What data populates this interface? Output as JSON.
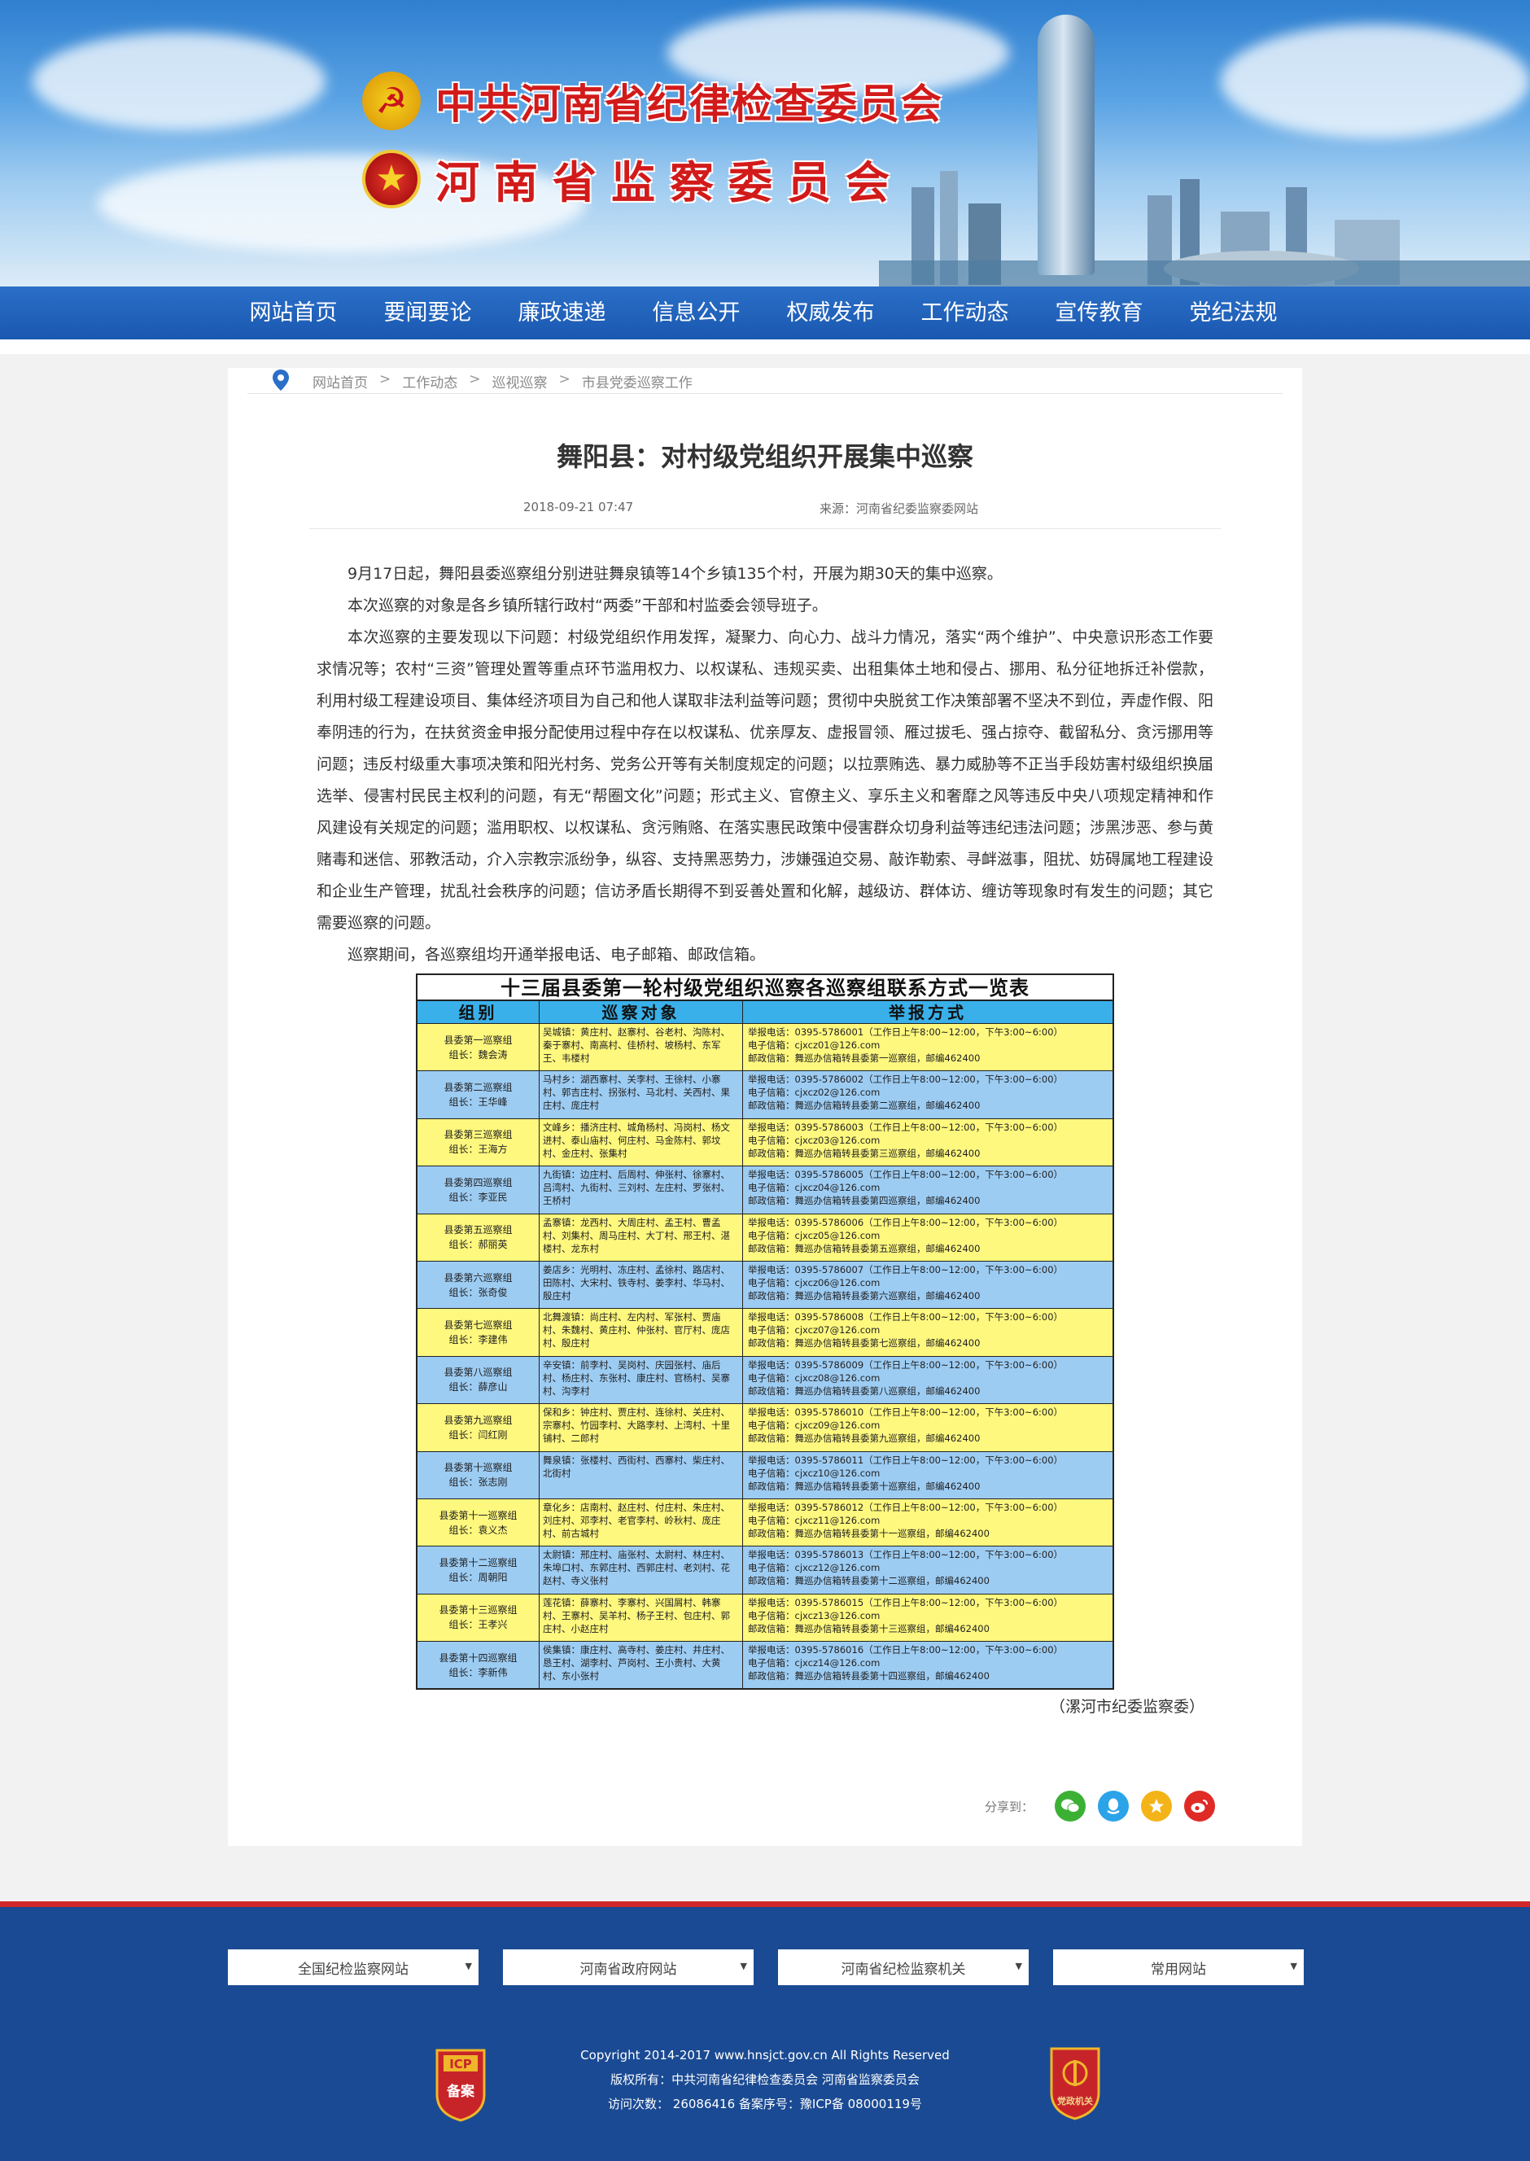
{
  "header": {
    "org_line1": "中共河南省纪律检查委员会",
    "org_line2": "河南省监察委员会"
  },
  "nav": {
    "items": [
      "网站首页",
      "要闻要论",
      "廉政速递",
      "信息公开",
      "权威发布",
      "工作动态",
      "宣传教育",
      "党纪法规"
    ]
  },
  "breadcrumb": [
    "网站首页",
    "工作动态",
    "巡视巡察",
    "市县党委巡察工作"
  ],
  "breadcrumb_sep": ">",
  "article": {
    "title": "舞阳县：对村级党组织开展集中巡察",
    "date": "2018-09-21 07:47",
    "source": "来源：河南省纪委监察委网站",
    "paragraphs": [
      "9月17日起，舞阳县委巡察组分别进驻舞泉镇等14个乡镇135个村，开展为期30天的集中巡察。",
      "本次巡察的对象是各乡镇所辖行政村“两委”干部和村监委会领导班子。",
      "本次巡察的主要发现以下问题：村级党组织作用发挥，凝聚力、向心力、战斗力情况，落实“两个维护”、中央意识形态工作要求情况等；农村“三资”管理处置等重点环节滥用权力、以权谋私、违规买卖、出租集体土地和侵占、挪用、私分征地拆迁补偿款，利用村级工程建设项目、集体经济项目为自己和他人谋取非法利益等问题；贯彻中央脱贫工作决策部署不坚决不到位，弄虚作假、阳奉阴违的行为，在扶贫资金申报分配使用过程中存在以权谋私、优亲厚友、虚报冒领、雁过拔毛、强占掠夺、截留私分、贪污挪用等问题；违反村级重大事项决策和阳光村务、党务公开等有关制度规定的问题；以拉票贿选、暴力威胁等不正当手段妨害村级组织换届选举、侵害村民民主权利的问题，有无“帮圈文化”问题；形式主义、官僚主义、享乐主义和奢靡之风等违反中央八项规定精神和作风建设有关规定的问题；滥用职权、以权谋私、贪污贿赂、在落实惠民政策中侵害群众切身利益等违纪违法问题；涉黑涉恶、参与黄赌毒和迷信、邪教活动，介入宗教宗派纷争，纵容、支持黑恶势力，涉嫌强迫交易、敲诈勒索、寻衅滋事，阻扰、妨碍属地工程建设和企业生产管理，扰乱社会秩序的问题；信访矛盾长期得不到妥善处置和化解，越级访、群体访、缠访等现象时有发生的问题；其它需要巡察的问题。",
      "巡察期间，各巡察组均开通举报电话、电子邮箱、邮政信箱。"
    ],
    "signature": "（漯河市纪委监察委）"
  },
  "table": {
    "title": "十三届县委第一轮村级党组织巡察各巡察组联系方式一览表",
    "headers": [
      "组别",
      "巡察对象",
      "举报方式"
    ],
    "rows": [
      {
        "group": "县委第一巡察组",
        "leader": "组长：魏会涛",
        "targets": "吴城镇：黄庄村、赵寨村、谷老村、沟陈村、秦于寨村、南高村、佳桥村、坡杨村、东军王、韦楼村",
        "phone": "举报电话：0395-5786001（工作日上午8:00~12:00，下午3:00~6:00）",
        "email": "电子信箱：cjxcz01@126.com",
        "mail": "邮政信箱：舞巡办信箱转县委第一巡察组，邮编462400"
      },
      {
        "group": "县委第二巡察组",
        "leader": "组长：王华峰",
        "targets": "马村乡：湖西寨村、关李村、王徐村、小寨村、郭吉庄村、拐张村、马北村、关西村、果庄村、庞庄村",
        "phone": "举报电话：0395-5786002（工作日上午8:00~12:00，下午3:00~6:00）",
        "email": "电子信箱：cjxcz02@126.com",
        "mail": "邮政信箱：舞巡办信箱转县委第二巡察组，邮编462400"
      },
      {
        "group": "县委第三巡察组",
        "leader": "组长：王海方",
        "targets": "文峰乡：播济庄村、城角杨村、冯岗村、杨文进村、泰山庙村、何庄村、马金陈村、郭坟村、金庄村、张集村",
        "phone": "举报电话：0395-5786003（工作日上午8:00~12:00，下午3:00~6:00）",
        "email": "电子信箱：cjxcz03@126.com",
        "mail": "邮政信箱：舞巡办信箱转县委第三巡察组，邮编462400"
      },
      {
        "group": "县委第四巡察组",
        "leader": "组长：李亚民",
        "targets": "九街镇：边庄村、后周村、伸张村、徐寨村、吕湾村、九街村、三刘村、左庄村、罗张村、王桥村",
        "phone": "举报电话：0395-5786005（工作日上午8:00~12:00，下午3:00~6:00）",
        "email": "电子信箱：cjxcz04@126.com",
        "mail": "邮政信箱：舞巡办信箱转县委第四巡察组，邮编462400"
      },
      {
        "group": "县委第五巡察组",
        "leader": "组长：郝丽英",
        "targets": "孟寨镇：龙西村、大周庄村、孟王村、曹孟村、刘集村、周马庄村、大丁村、邢王村、湛楼村、龙东村",
        "phone": "举报电话：0395-5786006（工作日上午8:00~12:00，下午3:00~6:00）",
        "email": "电子信箱：cjxcz05@126.com",
        "mail": "邮政信箱：舞巡办信箱转县委第五巡察组，邮编462400"
      },
      {
        "group": "县委第六巡察组",
        "leader": "组长：张奇俊",
        "targets": "姜店乡：光明村、冻庄村、孟徐村、路店村、田陈村、大宋村、铁寺村、姜李村、华马村、殷庄村",
        "phone": "举报电话：0395-5786007（工作日上午8:00~12:00，下午3:00~6:00）",
        "email": "电子信箱：cjxcz06@126.com",
        "mail": "邮政信箱：舞巡办信箱转县委第六巡察组，邮编462400"
      },
      {
        "group": "县委第七巡察组",
        "leader": "组长：李建伟",
        "targets": "北舞渡镇：尚庄村、左内村、军张村、贾庙村、朱魏村、黄庄村、仲张村、官厅村、庞店村、殷庄村",
        "phone": "举报电话：0395-5786008（工作日上午8:00~12:00，下午3:00~6:00）",
        "email": "电子信箱：cjxcz07@126.com",
        "mail": "邮政信箱：舞巡办信箱转县委第七巡察组，邮编462400"
      },
      {
        "group": "县委第八巡察组",
        "leader": "组长：薛彦山",
        "targets": "辛安镇：前李村、吴岗村、庆园张村、庙后村、杨庄村、东张村、康庄村、官杨村、吴寨村、沟李村",
        "phone": "举报电话：0395-5786009（工作日上午8:00~12:00，下午3:00~6:00）",
        "email": "电子信箱：cjxcz08@126.com",
        "mail": "邮政信箱：舞巡办信箱转县委第八巡察组，邮编462400"
      },
      {
        "group": "县委第九巡察组",
        "leader": "组长：闫红刚",
        "targets": "保和乡：钟庄村、贾庄村、连徐村、关庄村、宗寨村、竹园李村、大路李村、上湾村、十里铺村、二郎村",
        "phone": "举报电话：0395-5786010（工作日上午8:00~12:00，下午3:00~6:00）",
        "email": "电子信箱：cjxcz09@126.com",
        "mail": "邮政信箱：舞巡办信箱转县委第九巡察组，邮编462400"
      },
      {
        "group": "县委第十巡察组",
        "leader": "组长：张志刚",
        "targets": "舞泉镇：张楼村、西街村、西寨村、柴庄村、北街村",
        "phone": "举报电话：0395-5786011（工作日上午8:00~12:00，下午3:00~6:00）",
        "email": "电子信箱：cjxcz10@126.com",
        "mail": "邮政信箱：舞巡办信箱转县委第十巡察组，邮编462400"
      },
      {
        "group": "县委第十一巡察组",
        "leader": "组长：袁义杰",
        "targets": "章化乡：店南村、赵庄村、付庄村、朱庄村、刘庄村、邓李村、老官李村、岭秋村、庞庄村、前古城村",
        "phone": "举报电话：0395-5786012（工作日上午8:00~12:00，下午3:00~6:00）",
        "email": "电子信箱：cjxcz11@126.com",
        "mail": "邮政信箱：舞巡办信箱转县委第十一巡察组，邮编462400"
      },
      {
        "group": "县委第十二巡察组",
        "leader": "组长：周朝阳",
        "targets": "太尉镇：邢庄村、庙张村、太尉村、林庄村、朱埠口村、东郭庄村、西郭庄村、老刘村、花赵村、寺义张村",
        "phone": "举报电话：0395-5786013（工作日上午8:00~12:00，下午3:00~6:00）",
        "email": "电子信箱：cjxcz12@126.com",
        "mail": "邮政信箱：舞巡办信箱转县委第十二巡察组，邮编462400"
      },
      {
        "group": "县委第十三巡察组",
        "leader": "组长：王孝兴",
        "targets": "莲花镇：薛寨村、李寨村、兴国屑村、韩寨村、王寨村、吴羊村、杨子王村、包庄村、郭庄村、小赵庄村",
        "phone": "举报电话：0395-5786015（工作日上午8:00~12:00，下午3:00~6:00）",
        "email": "电子信箱：cjxcz13@126.com",
        "mail": "邮政信箱：舞巡办信箱转县委第十三巡察组，邮编462400"
      },
      {
        "group": "县委第十四巡察组",
        "leader": "组长：李新伟",
        "targets": "侯集镇：康庄村、高寺村、姜庄村、井庄村、恳王村、湖李村、芦岗村、王小贵村、大黄村、东小张村",
        "phone": "举报电话：0395-5786016（工作日上午8:00~12:00，下午3:00~6:00）",
        "email": "电子信箱：cjxcz14@126.com",
        "mail": "邮政信箱：舞巡办信箱转县委第十四巡察组，邮编462400"
      }
    ]
  },
  "share": {
    "label": "分享到：",
    "icons": [
      "wechat-icon",
      "qq-icon",
      "qzone-icon",
      "weibo-icon"
    ]
  },
  "footer": {
    "selects": [
      "全国纪检监察网站",
      "河南省政府网站",
      "河南省纪检监察机关",
      "常用网站"
    ],
    "copyright": "Copyright 2014-2017 www.hnsjct.gov.cn All Rights Reserved",
    "owner": "版权所有：中共河南省纪律检查委员会  河南省监察委员会",
    "visits": "访问次数：  26086416   备案序号：豫ICP备 08000119号",
    "icp_badge_top": "ICP",
    "icp_badge_bottom": "备案",
    "gov_badge": "党政机关"
  },
  "colors": {
    "nav": "#1f62bb",
    "footer": "#1a4a93",
    "footer_red": "#d0282a",
    "row_yellow": "#fff87e",
    "row_blue": "#9dccf3",
    "table_header": "#39b0ea",
    "title_red": "#d21a1a"
  }
}
